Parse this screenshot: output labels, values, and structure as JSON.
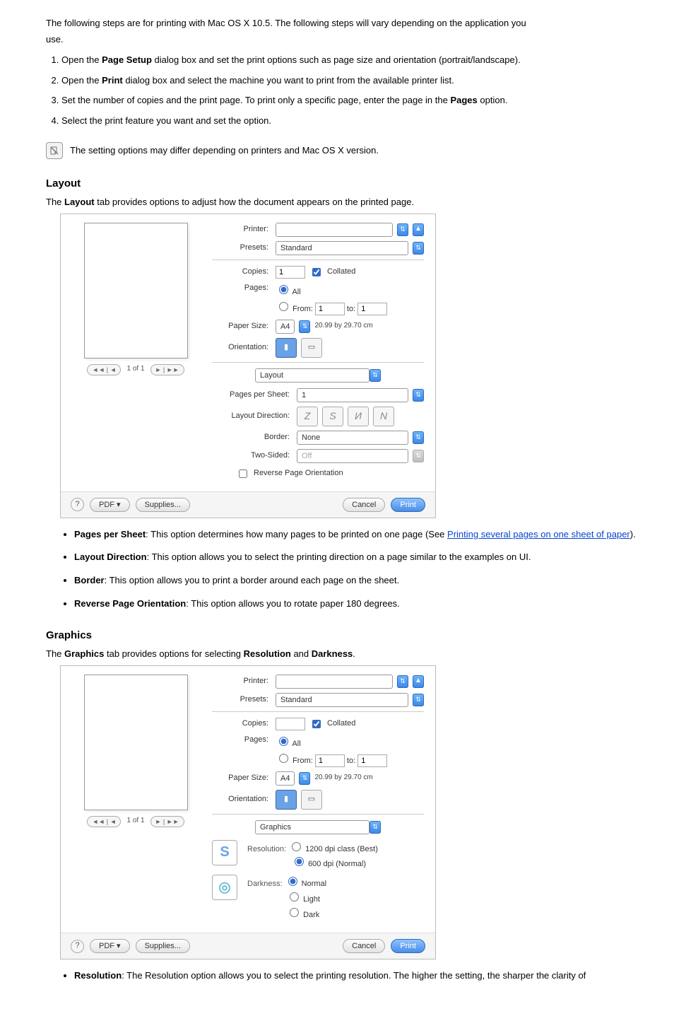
{
  "intro": {
    "line1": "The following steps are for printing with Mac OS X 10.5. The following steps will vary depending on the application you",
    "line2": "use."
  },
  "steps": {
    "s1_a": "Open the ",
    "s1_b": "Page Setup",
    "s1_c": " dialog box and set the print options such as page size and orientation (portrait/landscape).",
    "s2_a": "Open the ",
    "s2_b": "Print",
    "s2_c": " dialog box and select the machine you want to print from the available printer list.",
    "s3_a": "Set the number of copies and the print page. To print only a specific page, enter the page in the ",
    "s3_b": "Pages",
    "s3_c": " option.",
    "s4": "Select the print feature you want and set the option."
  },
  "note": "The setting options may differ depending on printers and Mac OS X version.",
  "layout": {
    "title": "Layout",
    "intro_a": "The ",
    "intro_b": "Layout",
    "intro_c": " tab provides options to adjust how the document appears on the printed page."
  },
  "layout_bullets": {
    "pps_a": "Pages per Sheet",
    "pps_b": ": This option determines how many pages to be printed on one page (See ",
    "pps_link": "Printing several pages on one sheet of paper",
    "pps_c": ").",
    "lyd_a": "Layout Direction",
    "lyd_b": ": This option allows you to select the printing direction on a page similar to the examples on UI.",
    "brd_a": "Border",
    "brd_b": ": This option allows you to print a border around each page on the sheet.",
    "rev_a": "Reverse Page Orientation",
    "rev_b": ": This option allows you to rotate paper 180 degrees."
  },
  "graphics": {
    "title": "Graphics",
    "intro_a": "The ",
    "intro_b": "Graphics",
    "intro_c": " tab provides options for selecting ",
    "intro_d": "Resolution",
    "intro_e": " and ",
    "intro_f": "Darkness",
    "intro_g": "."
  },
  "graphics_bullets": {
    "res_a": "Resolution",
    "res_b": ": The Resolution option allows you to select the printing resolution. The higher the setting, the sharper the clarity of"
  },
  "dlg": {
    "printer_lbl": "Printer:",
    "presets_lbl": "Presets:",
    "presets_val": "Standard",
    "copies_lbl": "Copies:",
    "copies_val": "1",
    "collated": "Collated",
    "pages_lbl": "Pages:",
    "all": "All",
    "from": "From:",
    "from_val": "1",
    "to": "to:",
    "to_val": "1",
    "papersize_lbl": "Paper Size:",
    "papersize_val": "A4",
    "paper_dim": "20.99 by 29.70 cm",
    "orient_lbl": "Orientation:",
    "section_layout": "Layout",
    "section_graphics": "Graphics",
    "pps_lbl": "Pages per Sheet:",
    "pps_val": "1",
    "ld_lbl": "Layout Direction:",
    "border_lbl": "Border:",
    "border_val": "None",
    "twosided_lbl": "Two-Sided:",
    "twosided_val": "Off",
    "reverse": "Reverse Page Orientation",
    "resolution_lbl": "Resolution:",
    "res_1200": "1200 dpi class (Best)",
    "res_600": "600 dpi (Normal)",
    "darkness_lbl": "Darkness:",
    "dk_normal": "Normal",
    "dk_light": "Light",
    "dk_dark": "Dark",
    "preview_pages": "1 of 1",
    "nav_prev": "◄◄ | ◄",
    "nav_next": "► | ►►",
    "help": "?",
    "pdf": "PDF ▾",
    "supplies": "Supplies...",
    "cancel": "Cancel",
    "print": "Print"
  }
}
